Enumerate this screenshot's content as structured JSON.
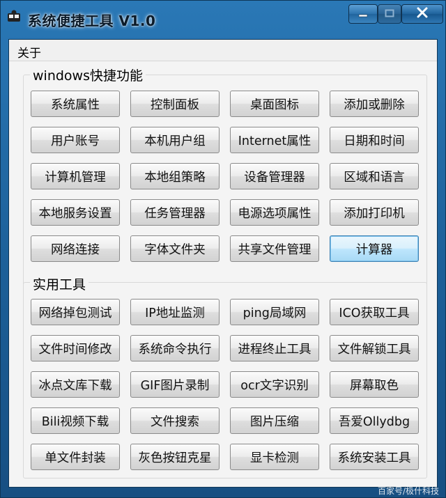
{
  "window": {
    "title": "系统便捷工具 V1.0"
  },
  "menu": {
    "items": [
      "关于"
    ]
  },
  "groups": [
    {
      "title": "windows快捷功能",
      "buttons": [
        "系统属性",
        "控制面板",
        "桌面图标",
        "添加或删除",
        "用户账号",
        "本机用户组",
        "Internet属性",
        "日期和时间",
        "计算机管理",
        "本地组策略",
        "设备管理器",
        "区域和语言",
        "本地服务设置",
        "任务管理器",
        "电源选项属性",
        "添加打印机",
        "网络连接",
        "字体文件夹",
        "共享文件管理",
        "计算器"
      ],
      "focused": "计算器"
    },
    {
      "title": "实用工具",
      "buttons": [
        "网络掉包测试",
        "IP地址监测",
        "ping局域网",
        "ICO获取工具",
        "文件时间修改",
        "系统命令执行",
        "进程终止工具",
        "文件解锁工具",
        "冰点文库下载",
        "GIF图片录制",
        "ocr文字识别",
        "屏幕取色",
        "Bili视频下载",
        "文件搜索",
        "图片压缩",
        "吾爱Ollydbg",
        "单文件封装",
        "灰色按钮克星",
        "显卡检测",
        "系统安装工具"
      ]
    }
  ],
  "watermark": "百家号/极什科技",
  "icons": {
    "app": "puzzle-app-icon",
    "minimize": "minimize-icon",
    "maximize": "maximize-icon",
    "close": "close-icon"
  }
}
